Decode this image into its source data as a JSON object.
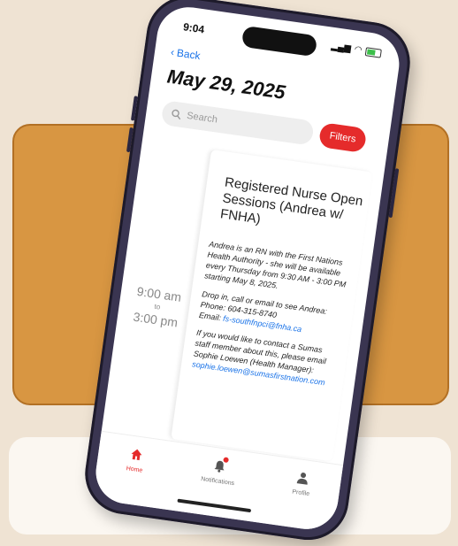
{
  "status": {
    "time": "9:04"
  },
  "nav": {
    "back_label": "Back"
  },
  "page": {
    "title": "May 29, 2025"
  },
  "search": {
    "placeholder": "Search"
  },
  "filters": {
    "label": "Filters"
  },
  "event": {
    "title": "Registered Nurse Open Sessions (Andrea w/ FNHA)",
    "time_start": "9:00 am",
    "time_to": "to",
    "time_end": "3:00 pm",
    "paragraph1": "Andrea is an RN with the First Nations Health Authority - she will be available every Thursday from 9:30 AM - 3:00 PM starting May 8, 2025.",
    "paragraph2_line1": "Drop in, call or email to see Andrea:",
    "phone_line": "Phone: 604-315-8740",
    "email_prefix": "Email: ",
    "email": "fs-southfnpci@fnha.ca",
    "paragraph3": "If you would like to contact a Sumas staff member about this, please email Sophie Loewen (Health Manager):",
    "contact_email": "sophie.loewen@sumasfirstnation.com"
  },
  "tabs": [
    {
      "label": "Home",
      "icon": "home-icon"
    },
    {
      "label": "Notifications",
      "icon": "bell-icon"
    },
    {
      "label": "Profile",
      "icon": "user-icon"
    }
  ],
  "colors": {
    "accent": "#e52b2b",
    "link": "#1a73e8",
    "orange_card": "#d89642",
    "background": "#efe3d3"
  }
}
